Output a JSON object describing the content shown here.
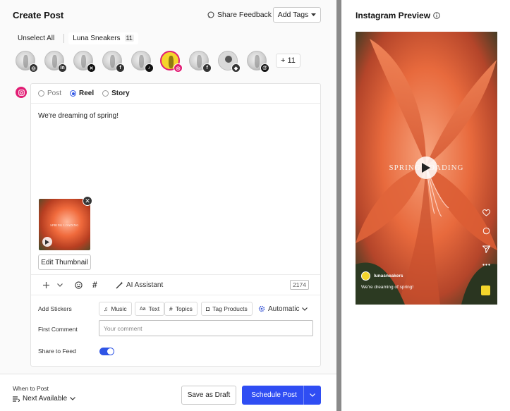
{
  "header": {
    "title": "Create Post",
    "share_feedback": "Share Feedback",
    "add_tags": "Add Tags"
  },
  "selection": {
    "unselect_all": "Unselect All",
    "group_name": "Luna Sneakers",
    "group_count": "11"
  },
  "accounts": {
    "more_label": "+ 11",
    "badges": [
      {
        "icon": "instagram-icon",
        "glyph": "◎",
        "color": "#333333"
      },
      {
        "icon": "linkedin-icon",
        "glyph": "in",
        "color": "#333333"
      },
      {
        "icon": "x-icon",
        "glyph": "✕",
        "color": "#111111"
      },
      {
        "icon": "facebook-icon",
        "glyph": "f",
        "color": "#333333"
      },
      {
        "icon": "tiktok-icon",
        "glyph": "♪",
        "color": "#111111"
      },
      {
        "icon": "instagram-icon",
        "glyph": "◎",
        "color": "#e11d74"
      },
      {
        "icon": "facebook-icon",
        "glyph": "f",
        "color": "#333333"
      },
      {
        "icon": "bluesky-icon",
        "glyph": "◆",
        "color": "#333333"
      },
      {
        "icon": "threads-icon",
        "glyph": "@",
        "color": "#111111"
      }
    ]
  },
  "post_types": {
    "post": "Post",
    "reel": "Reel",
    "story": "Story",
    "selected": "Reel"
  },
  "editor": {
    "caption": "We're dreaming of spring!",
    "media_overlay_text": "SPRING LOADING",
    "edit_thumbnail": "Edit Thumbnail",
    "ai_assistant": "AI Assistant",
    "char_count": "2174"
  },
  "stickers": {
    "label": "Add Stickers",
    "music": "Music",
    "text": "Text",
    "topics": "Topics",
    "tag_products": "Tag Products",
    "automatic": "Automatic"
  },
  "first_comment": {
    "label": "First Comment",
    "placeholder": "Your comment"
  },
  "share_to_feed": {
    "label": "Share to Feed",
    "enabled": true
  },
  "footer": {
    "when_label": "When to Post",
    "when_value": "Next Available",
    "save_draft": "Save as Draft",
    "schedule": "Schedule Post"
  },
  "preview": {
    "title": "Instagram Preview",
    "username": "lunasneakers",
    "caption": "We're dreaming of spring!",
    "overlay_text": "SPRING LOADING"
  },
  "colors": {
    "accent": "#2f4df3",
    "instagram": "#e11d74",
    "avatar_yellow": "#f4d52b"
  }
}
